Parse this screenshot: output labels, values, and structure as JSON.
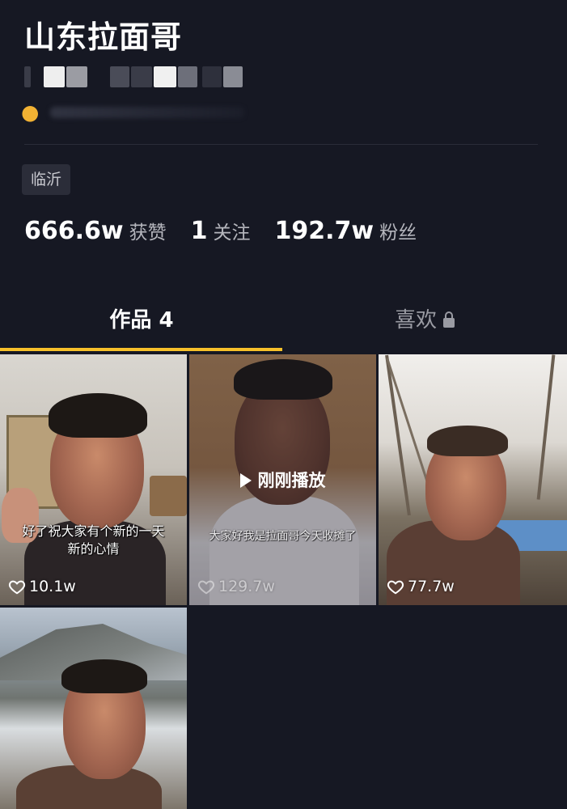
{
  "profile": {
    "name": "山东拉面哥",
    "location": "临沂"
  },
  "stats": [
    {
      "value": "666.6w",
      "label": "获赞"
    },
    {
      "value": "1",
      "label": "关注"
    },
    {
      "value": "192.7w",
      "label": "粉丝"
    }
  ],
  "tabs": {
    "works_label": "作品 4",
    "likes_label": "喜欢"
  },
  "videos": [
    {
      "caption_line1": "好了祝大家有个新的一天",
      "caption_line2": "新的心情",
      "likes": "10.1w"
    },
    {
      "caption_line1": "大家好我是拉面哥今天收摊了",
      "caption_line2": "",
      "likes": "129.7w",
      "played_label": "刚刚播放"
    },
    {
      "caption_line1": "",
      "caption_line2": "",
      "likes": "77.7w"
    },
    {
      "caption_line1": "",
      "caption_line2": "",
      "likes": ""
    }
  ],
  "colors": {
    "background": "#161823",
    "tab_indicator": "#f7c02a",
    "tag_background": "#2b2d39"
  }
}
